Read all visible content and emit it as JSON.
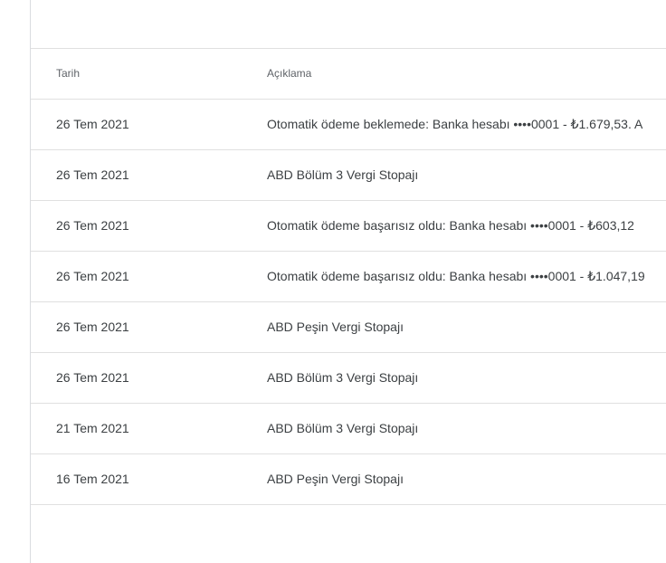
{
  "table": {
    "headers": {
      "date": "Tarih",
      "description": "Açıklama"
    },
    "rows": [
      {
        "date": "26 Tem 2021",
        "description": "Otomatik ödeme beklemede: Banka hesabı ••••0001 - ₺1.679,53. A"
      },
      {
        "date": "26 Tem 2021",
        "description": "ABD Bölüm 3 Vergi Stopajı"
      },
      {
        "date": "26 Tem 2021",
        "description": "Otomatik ödeme başarısız oldu: Banka hesabı ••••0001 - ₺603,12"
      },
      {
        "date": "26 Tem 2021",
        "description": "Otomatik ödeme başarısız oldu: Banka hesabı ••••0001 - ₺1.047,19"
      },
      {
        "date": "26 Tem 2021",
        "description": "ABD Peşin Vergi Stopajı"
      },
      {
        "date": "26 Tem 2021",
        "description": "ABD Bölüm 3 Vergi Stopajı"
      },
      {
        "date": "21 Tem 2021",
        "description": "ABD Bölüm 3 Vergi Stopajı"
      },
      {
        "date": "16 Tem 2021",
        "description": "ABD Peşin Vergi Stopajı"
      }
    ]
  }
}
